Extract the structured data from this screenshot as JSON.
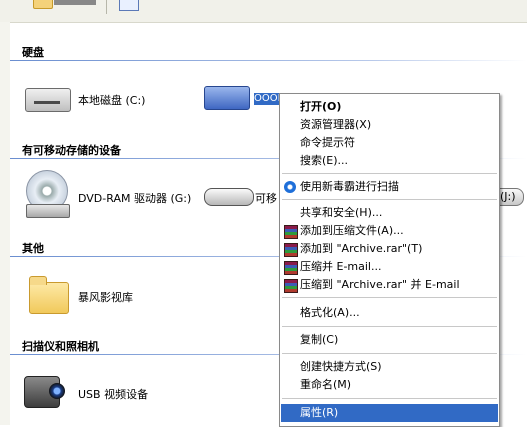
{
  "groups": {
    "hard_disks": "硬盘",
    "removable": "有可移动存储的设备",
    "other": "其他",
    "scanners": "扫描仪和照相机"
  },
  "items": {
    "local_disk": "本地磁盘 (C:)",
    "selected_drive": "OOOL",
    "dvd": "DVD-RAM 驱动器 (G:)",
    "removable_partial": "可移",
    "right_partial": "(J:)",
    "baofeng": "暴风影视库",
    "usb_video": "USB 视频设备"
  },
  "context_menu": [
    {
      "label": "打开(O)",
      "bold": true
    },
    {
      "label": "资源管理器(X)"
    },
    {
      "label": "命令提示符"
    },
    {
      "label": "搜索(E)..."
    },
    {
      "separator": true
    },
    {
      "label": "使用新毒霸进行扫描",
      "icon": "scan-icon"
    },
    {
      "separator": true
    },
    {
      "label": "共享和安全(H)..."
    },
    {
      "label": "添加到压缩文件(A)...",
      "icon": "winrar-icon"
    },
    {
      "label": "添加到 \"Archive.rar\"(T)",
      "icon": "winrar-icon"
    },
    {
      "label": "压缩并 E-mail...",
      "icon": "winrar-icon"
    },
    {
      "label": "压缩到 \"Archive.rar\" 并 E-mail",
      "icon": "winrar-icon"
    },
    {
      "separator": true
    },
    {
      "label": "格式化(A)..."
    },
    {
      "separator": true
    },
    {
      "label": "复制(C)"
    },
    {
      "separator": true
    },
    {
      "label": "创建快捷方式(S)"
    },
    {
      "label": "重命名(M)"
    },
    {
      "separator": true
    },
    {
      "label": "属性(R)",
      "highlighted": true
    }
  ],
  "colors": {
    "selection": "#316ac5",
    "group_line": "#6a8ed0"
  }
}
